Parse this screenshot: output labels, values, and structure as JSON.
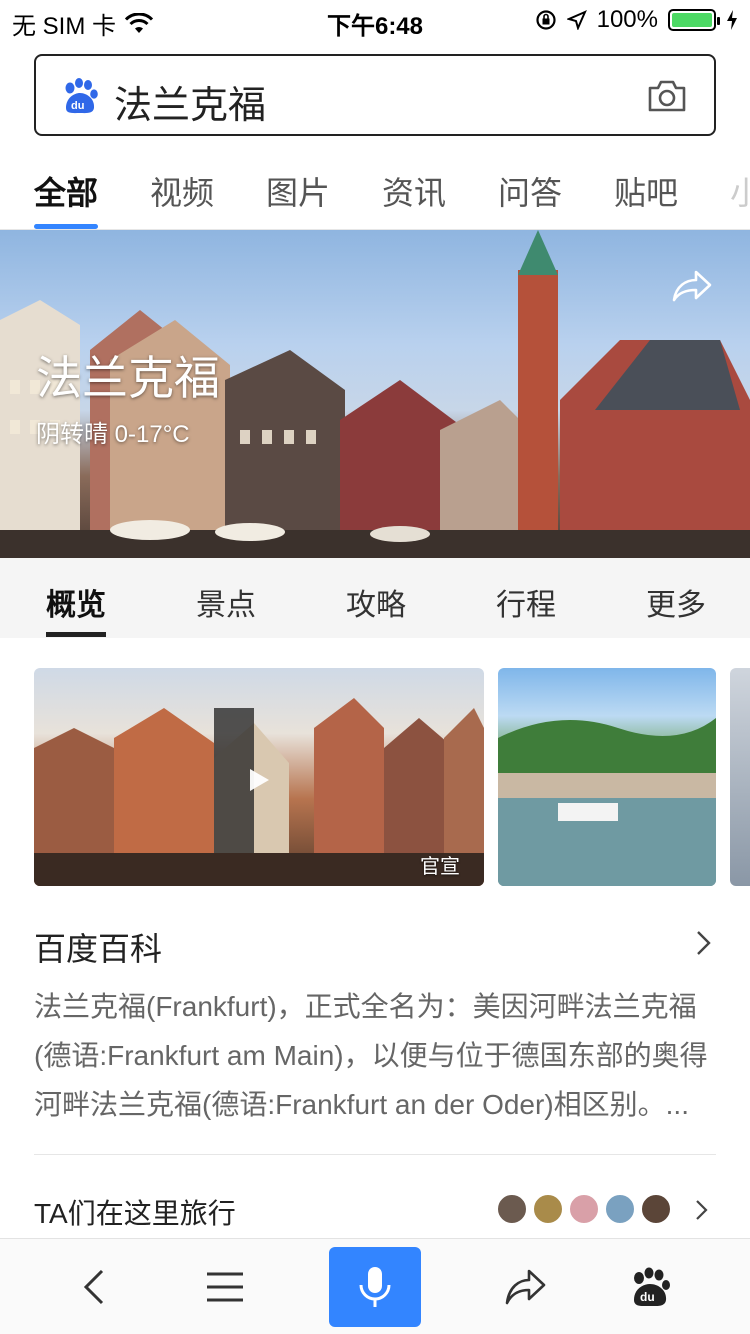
{
  "status_bar": {
    "carrier": "无 SIM 卡",
    "time": "下午6:48",
    "battery": "100%"
  },
  "search": {
    "query": "法兰克福",
    "logo_icon": "baidu-paw-icon",
    "camera_icon": "camera-icon"
  },
  "tabs": [
    {
      "label": "全部",
      "active": true
    },
    {
      "label": "视频"
    },
    {
      "label": "图片"
    },
    {
      "label": "资讯"
    },
    {
      "label": "问答"
    },
    {
      "label": "贴吧"
    },
    {
      "label": "小"
    }
  ],
  "hero": {
    "title": "法兰克福",
    "weather": "阴转晴 0-17°C",
    "share_icon": "share-icon"
  },
  "subtabs": [
    {
      "label": "概览",
      "active": true
    },
    {
      "label": "景点"
    },
    {
      "label": "攻略"
    },
    {
      "label": "行程"
    },
    {
      "label": "更多"
    }
  ],
  "media": {
    "video_badge": "官宣",
    "play_icon": "play-icon"
  },
  "baike": {
    "title": "百度百科",
    "summary": "法兰克福(Frankfurt)，正式全名为：美因河畔法兰克福(德语:Frankfurt am Main)，以便与位于德国东部的奥得河畔法兰克福(德语:Frankfurt an der Oder)相区别。..."
  },
  "travel": {
    "label": "TA们在这里旅行",
    "avatar_colors": [
      "#6b5a4f",
      "#a98b4a",
      "#d9a0a8",
      "#7aa1c0",
      "#5b4538"
    ]
  },
  "bottom_bar": {
    "back_icon": "back-icon",
    "menu_icon": "menu-icon",
    "mic_icon": "microphone-icon",
    "share_icon": "share-icon",
    "home_icon": "baidu-paw-icon",
    "accent": "#3385ff"
  }
}
